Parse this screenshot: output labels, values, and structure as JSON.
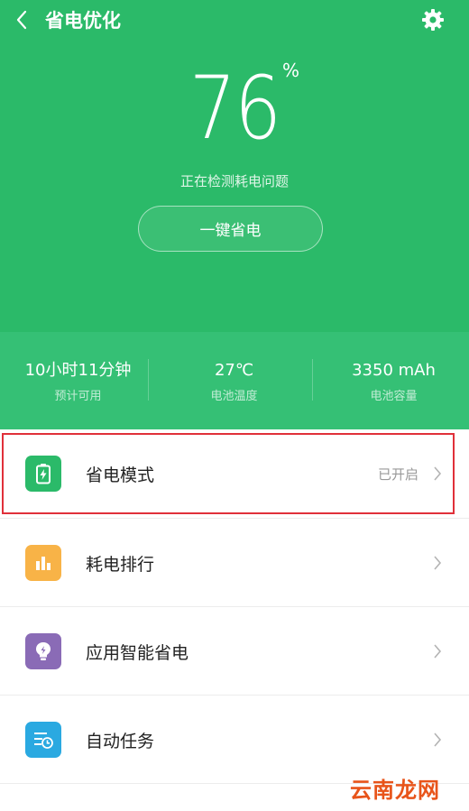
{
  "header": {
    "title": "省电优化",
    "back_icon": "chevron-left-icon",
    "settings_icon": "gear-icon",
    "bg_color": "#2bba69"
  },
  "battery": {
    "percent": "76",
    "unit": "%",
    "status": "正在检测耗电问题",
    "action_label": "一键省电"
  },
  "stats": [
    {
      "value": "10小时11分钟",
      "label": "预计可用"
    },
    {
      "value": "27℃",
      "label": "电池温度"
    },
    {
      "value": "3350 mAh",
      "label": "电池容量"
    }
  ],
  "menu": [
    {
      "label": "省电模式",
      "status": "已开启",
      "icon": "battery-charging-icon",
      "color": "#2bba69"
    },
    {
      "label": "耗电排行",
      "status": "",
      "icon": "bar-chart-icon",
      "color": "#f8b347"
    },
    {
      "label": "应用智能省电",
      "status": "",
      "icon": "lightbulb-icon",
      "color": "#8a6bb6"
    },
    {
      "label": "自动任务",
      "status": "",
      "icon": "scheduled-list-icon",
      "color": "#2aa9e1"
    }
  ],
  "highlight_color": "#e0303a",
  "watermark": "云南龙网"
}
